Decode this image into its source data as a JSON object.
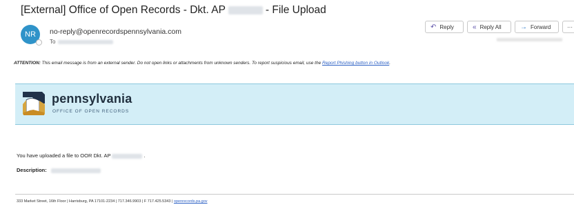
{
  "email": {
    "subject": {
      "prefix": "[External] Office of Open Records - Dkt. AP",
      "suffix": "- File Upload"
    },
    "sender": {
      "initials": "NR",
      "address": "no-reply@openrecordspennsylvania.com",
      "to_label": "To"
    },
    "toolbar": {
      "reply": "Reply",
      "reply_all": "Reply All",
      "forward": "Forward",
      "more": "···"
    }
  },
  "attention": {
    "label": "ATTENTION:",
    "text": " This email message is from an external sender. Do not open links or attachments from unknown senders. To report suspicious email, use the ",
    "link": "Report Phishing button in Outlook",
    "end": "."
  },
  "banner": {
    "brand": "pennsylvania",
    "subtitle": "OFFICE OF OPEN RECORDS"
  },
  "body": {
    "upload_prefix": "You have uploaded a file to OOR Dkt. AP",
    "upload_suffix": ".",
    "description_label": "Description:"
  },
  "footer": {
    "address": "333 Market Street, 16th Floor | Harrisburg, PA 17101-2234 | 717.346.9903 | F 717.425.5343 | ",
    "link": "openrecords.pa.gov"
  },
  "colors": {
    "avatar": "#2f93c9",
    "banner": "#d3eef7",
    "link": "#2a5fc4",
    "brand_text": "#21303f"
  }
}
